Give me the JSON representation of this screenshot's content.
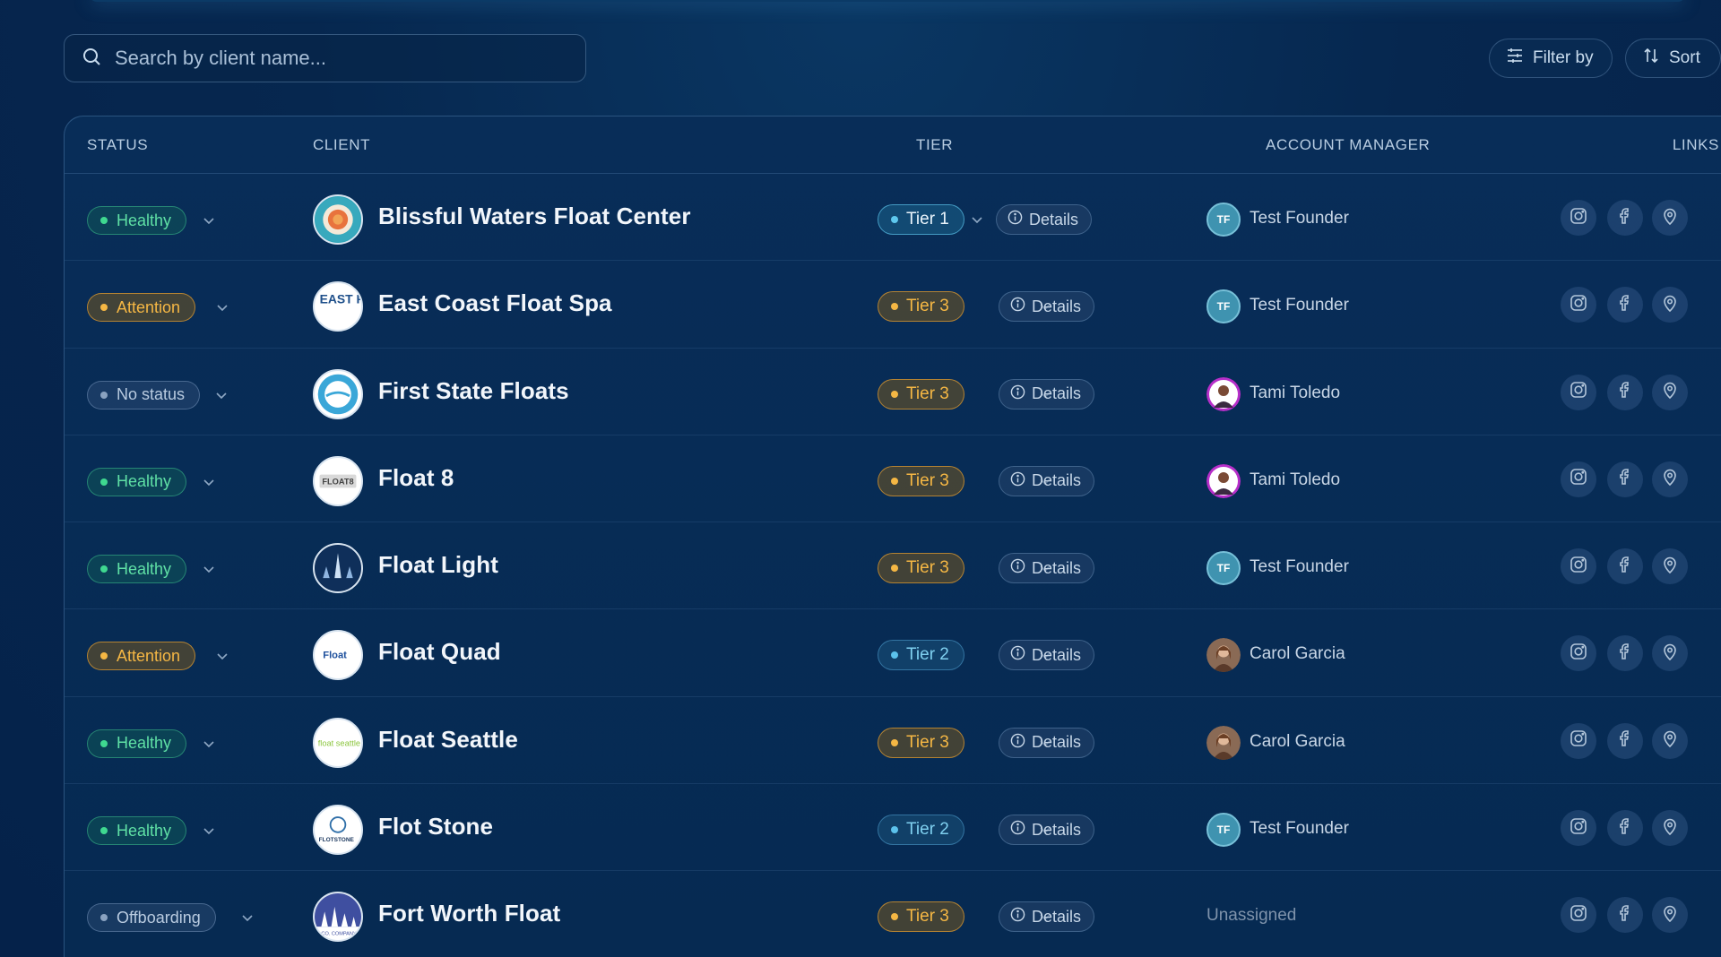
{
  "search": {
    "placeholder": "Search by client name..."
  },
  "toolbar": {
    "filter_label": "Filter by",
    "sort_label": "Sort"
  },
  "table": {
    "headers": {
      "status": "STATUS",
      "client": "CLIENT",
      "tier": "TIER",
      "manager": "ACCOUNT MANAGER",
      "links": "LINKS"
    },
    "details_label": "Details",
    "rows": [
      {
        "status": "Healthy",
        "client": "Blissful Waters Float Center",
        "tier": "Tier 1",
        "manager": "Test Founder",
        "manager_initials": "TF"
      },
      {
        "status": "Attention",
        "client": "East Coast Float Spa",
        "tier": "Tier 3",
        "manager": "Test Founder",
        "manager_initials": "TF"
      },
      {
        "status": "No status",
        "client": "First State Floats",
        "tier": "Tier 3",
        "manager": "Tami Toledo"
      },
      {
        "status": "Healthy",
        "client": "Float 8",
        "tier": "Tier 3",
        "manager": "Tami Toledo"
      },
      {
        "status": "Healthy",
        "client": "Float Light",
        "tier": "Tier 3",
        "manager": "Test Founder",
        "manager_initials": "TF"
      },
      {
        "status": "Attention",
        "client": "Float Quad",
        "tier": "Tier 2",
        "manager": "Carol Garcia"
      },
      {
        "status": "Healthy",
        "client": "Float Seattle",
        "tier": "Tier 3",
        "manager": "Carol Garcia"
      },
      {
        "status": "Healthy",
        "client": "Flot Stone",
        "tier": "Tier 2",
        "manager": "Test Founder",
        "manager_initials": "TF"
      },
      {
        "status": "Offboarding",
        "client": "Fort Worth Float",
        "tier": "Tier 3",
        "manager": "Unassigned"
      }
    ]
  },
  "logo_text": {
    "east_coast": "EAST FLOA",
    "float8": "FLOAT8",
    "float_quad": "Float",
    "float_seattle": "float seattle",
    "flot_stone": "FLOTSTONE",
    "fort_worth": "CO. COMPANY"
  },
  "colors": {
    "background": "#06274f",
    "healthy": "#5fe0a5",
    "attention": "#f5b744",
    "tier_blue": "#5ec8ee",
    "avatar_tf": "#3f93b0"
  },
  "icons": {
    "search": "search-icon",
    "filter": "sliders-icon",
    "sort": "sort-arrows-icon",
    "chevron": "chevron-down-icon",
    "details": "info-icon",
    "instagram": "instagram-icon",
    "facebook": "facebook-icon",
    "map": "map-pin-icon"
  }
}
